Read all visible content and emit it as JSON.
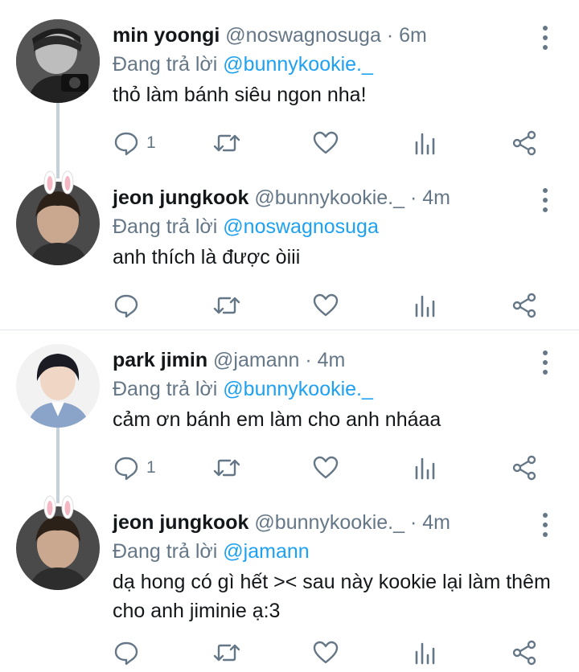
{
  "colors": {
    "text": "#14171a",
    "secondary": "#657786",
    "link": "#1da1f2",
    "thread_line": "#c6d0d8",
    "divider": "#e1e8ed"
  },
  "reply_prefix": "Đang trả lời",
  "tweets": [
    {
      "name": "min yoongi",
      "handle": "@noswagnosuga",
      "separator": "·",
      "time": "6m",
      "mention": "@bunnykookie._",
      "text": "thỏ làm bánh siêu ngon nha!",
      "reply_count": "1"
    },
    {
      "name": "jeon jungkook",
      "handle": "@bunnykookie._",
      "separator": "·",
      "time": "4m",
      "mention": "@noswagnosuga",
      "text": "anh thích là được òiii",
      "reply_count": ""
    },
    {
      "name": "park jimin",
      "handle": "@jamann",
      "separator": "·",
      "time": "4m",
      "mention": "@bunnykookie._",
      "text": "cảm ơn bánh em làm cho anh nháaa",
      "reply_count": "1"
    },
    {
      "name": "jeon jungkook",
      "handle": "@bunnykookie._",
      "separator": "·",
      "time": "4m",
      "mention": "@jamann",
      "text": "dạ hong có gì hết >< sau này kookie lại làm thêm cho anh jiminie ạ:3",
      "reply_count": ""
    }
  ],
  "icons": {
    "reply": "reply-icon",
    "retweet": "retweet-icon",
    "like": "heart-icon",
    "analytics": "analytics-icon",
    "share": "share-icon",
    "more": "more-options-icon"
  }
}
